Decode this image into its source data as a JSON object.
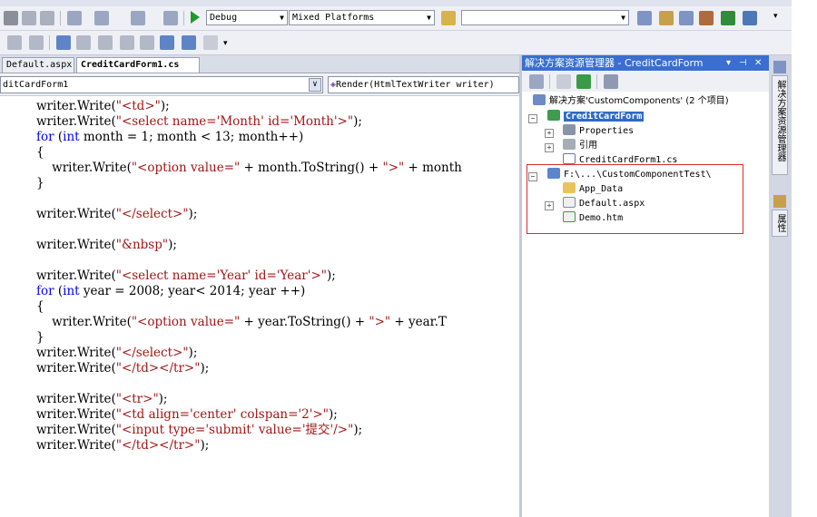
{
  "toolbar": {
    "config": "Debug",
    "platform": "Mixed Platforms",
    "search": ""
  },
  "editor": {
    "tabs": [
      {
        "label": "Default.aspx",
        "active": false
      },
      {
        "label": "CreditCardForm1.cs",
        "active": true
      }
    ],
    "class_dropdown": "ditCardForm1",
    "member_dropdown": "Render(HtmlTextWriter writer)",
    "lines": [
      "writer.Write(\"<td>\");",
      "writer.Write(\"<select name='Month' id='Month'>\");",
      "for (int month = 1; month < 13; month++)",
      "{",
      "    writer.Write(\"<option value=\" + month.ToString() + \">\" + month",
      "}",
      "",
      "writer.Write(\"</select>\");",
      "",
      "writer.Write(\"&nbsp\");",
      "",
      "writer.Write(\"<select name='Year' id='Year'>\");",
      "for (int year = 2008; year< 2014; year ++)",
      "{",
      "    writer.Write(\"<option value=\" + year.ToString() + \">\" + year.T",
      "}",
      "writer.Write(\"</select>\");",
      "writer.Write(\"</td></tr>\");",
      "",
      "writer.Write(\"<tr>\");",
      "writer.Write(\"<td align='center' colspan='2'>\");",
      "writer.Write(\"<input type='submit' value='提交'/>\");",
      "writer.Write(\"</td></tr>\");"
    ]
  },
  "solution_explorer": {
    "title": "解决方案资源管理器 - CreditCardForm",
    "pin": "▾ ⊣ ✕",
    "solution": "解决方案'CustomComponents' (2 个项目)",
    "project": "CreditCardForm",
    "properties": "Properties",
    "references": "引用",
    "cs_file": "CreditCardForm1.cs",
    "website": "F:\\...\\CustomComponentTest\\",
    "app_data": "App_Data",
    "default_aspx": "Default.aspx",
    "demo_htm": "Demo.htm"
  },
  "side_tabs": {
    "solution_tab": "解决方案资源管理器",
    "properties_tab": "属性"
  },
  "colors": {
    "keyword": "#0000ff",
    "string": "#a31515",
    "selection": "#3169c6",
    "highlight_box": "#e0292d"
  }
}
